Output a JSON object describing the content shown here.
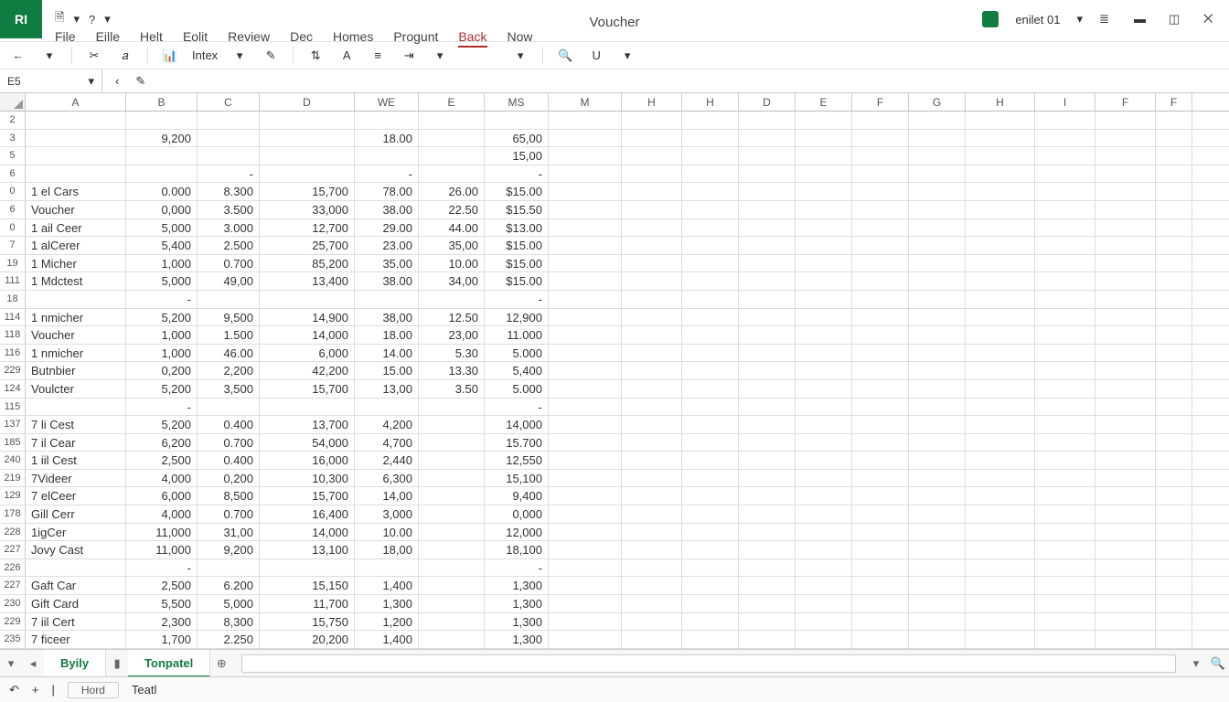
{
  "app_badge": "RI",
  "title": "Voucher",
  "account": "enilet 01",
  "qat": {
    "undo": "↶",
    "help": "?",
    "drop": "▾"
  },
  "menus": [
    "File",
    "Eille",
    "Helt",
    "Eolit",
    "Review",
    "Dec",
    "Homes",
    "Progunt",
    "Back",
    "Now"
  ],
  "active_menu": 8,
  "toolbar": {
    "back": "←",
    "intex": "Intex"
  },
  "namebox": "E5",
  "columns": [
    "A",
    "B",
    "C",
    "D",
    "WE",
    "E",
    "MS",
    "M",
    "H",
    "H",
    "D",
    "E",
    "F",
    "G",
    "H",
    "I",
    "F",
    "F"
  ],
  "col_classes": [
    "wA",
    "wB",
    "wC",
    "wD",
    "wWE",
    "wE",
    "wMS",
    "wM",
    "wH",
    "wHH",
    "wD2",
    "wE2",
    "wF",
    "wG",
    "wH2",
    "wI",
    "wF2",
    "wF3"
  ],
  "rows": [
    {
      "n": "2",
      "c": [
        "",
        "",
        "",
        "",
        "",
        "",
        "",
        "",
        "",
        "",
        "",
        "",
        "",
        "",
        "",
        "",
        "",
        ""
      ]
    },
    {
      "n": "3",
      "c": [
        "",
        "9,200",
        "",
        "",
        "18.00",
        "",
        "65,00",
        "",
        "",
        "",
        "",
        "",
        "",
        "",
        "",
        "",
        "",
        ""
      ]
    },
    {
      "n": "5",
      "c": [
        "",
        "",
        "",
        "",
        "",
        "",
        "15,00",
        "",
        "",
        "",
        "",
        "",
        "",
        "",
        "",
        "",
        "",
        ""
      ]
    },
    {
      "n": "6",
      "c": [
        "",
        "",
        "-",
        "",
        "-",
        "",
        "-",
        "",
        "",
        "",
        "",
        "",
        "",
        "",
        "",
        "",
        "",
        ""
      ]
    },
    {
      "n": "0",
      "c": [
        "1 el Cars",
        "0.000",
        "8.300",
        "15,700",
        "78.00",
        "26.00",
        "$15.00",
        "",
        "",
        "",
        "",
        "",
        "",
        "",
        "",
        "",
        "",
        ""
      ]
    },
    {
      "n": "6",
      "c": [
        "Voucher",
        "0,000",
        "3.500",
        "33,000",
        "38.00",
        "22.50",
        "$15.50",
        "",
        "",
        "",
        "",
        "",
        "",
        "",
        "",
        "",
        "",
        ""
      ]
    },
    {
      "n": "0",
      "c": [
        "1 ail Ceer",
        "5,000",
        "3.000",
        "12,700",
        "29.00",
        "44.00",
        "$13.00",
        "",
        "",
        "",
        "",
        "",
        "",
        "",
        "",
        "",
        "",
        ""
      ]
    },
    {
      "n": "7",
      "c": [
        "1 alCerer",
        "5,400",
        "2.500",
        "25,700",
        "23.00",
        "35,00",
        "$15.00",
        "",
        "",
        "",
        "",
        "",
        "",
        "",
        "",
        "",
        "",
        ""
      ]
    },
    {
      "n": "19",
      "c": [
        "1 Micher",
        "1,000",
        "0.700",
        "85,200",
        "35.00",
        "10.00",
        "$15.00",
        "",
        "",
        "",
        "",
        "",
        "",
        "",
        "",
        "",
        "",
        ""
      ]
    },
    {
      "n": "111",
      "c": [
        "1 Mdctest",
        "5,000",
        "49,00",
        "13,400",
        "38.00",
        "34,00",
        "$15.00",
        "",
        "",
        "",
        "",
        "",
        "",
        "",
        "",
        "",
        "",
        ""
      ]
    },
    {
      "n": "18",
      "c": [
        "",
        "-",
        "",
        "",
        "",
        "",
        "-",
        "",
        "",
        "",
        "",
        "",
        "",
        "",
        "",
        "",
        "",
        ""
      ]
    },
    {
      "n": "114",
      "c": [
        "1 nmicher",
        "5,200",
        "9,500",
        "14,900",
        "38,00",
        "12.50",
        "12,900",
        "",
        "",
        "",
        "",
        "",
        "",
        "",
        "",
        "",
        "",
        ""
      ]
    },
    {
      "n": "118",
      "c": [
        "Voucher",
        "1,000",
        "1.500",
        "14,000",
        "18.00",
        "23,00",
        "11.000",
        "",
        "",
        "",
        "",
        "",
        "",
        "",
        "",
        "",
        "",
        ""
      ]
    },
    {
      "n": "116",
      "c": [
        "1 nmicher",
        "1,000",
        "46.00",
        "6,000",
        "14.00",
        "5.30",
        "5.000",
        "",
        "",
        "",
        "",
        "",
        "",
        "",
        "",
        "",
        "",
        ""
      ]
    },
    {
      "n": "229",
      "c": [
        "Butnbier",
        "0,200",
        "2,200",
        "42,200",
        "15.00",
        "13.30",
        "5,400",
        "",
        "",
        "",
        "",
        "",
        "",
        "",
        "",
        "",
        "",
        ""
      ]
    },
    {
      "n": "124",
      "c": [
        "Voulcter",
        "5,200",
        "3,500",
        "15,700",
        "13,00",
        "3.50",
        "5.000",
        "",
        "",
        "",
        "",
        "",
        "",
        "",
        "",
        "",
        "",
        ""
      ]
    },
    {
      "n": "115",
      "c": [
        "",
        "-",
        "",
        "",
        "",
        "",
        "-",
        "",
        "",
        "",
        "",
        "",
        "",
        "",
        "",
        "",
        "",
        ""
      ]
    },
    {
      "n": "137",
      "c": [
        "7 li Cest",
        "5,200",
        "0.400",
        "13,700",
        "4,200",
        "",
        "14,000",
        "",
        "",
        "",
        "",
        "",
        "",
        "",
        "",
        "",
        "",
        ""
      ]
    },
    {
      "n": "185",
      "c": [
        "7 il Cear",
        "6,200",
        "0.700",
        "54,000",
        "4,700",
        "",
        "15.700",
        "",
        "",
        "",
        "",
        "",
        "",
        "",
        "",
        "",
        "",
        ""
      ]
    },
    {
      "n": "240",
      "c": [
        "1 iil Cest",
        "2,500",
        "0.400",
        "16,000",
        "2,440",
        "",
        "12,550",
        "",
        "",
        "",
        "",
        "",
        "",
        "",
        "",
        "",
        "",
        ""
      ]
    },
    {
      "n": "219",
      "c": [
        "7Videer",
        "4,000",
        "0,200",
        "10,300",
        "6,300",
        "",
        "15,100",
        "",
        "",
        "",
        "",
        "",
        "",
        "",
        "",
        "",
        "",
        ""
      ]
    },
    {
      "n": "129",
      "c": [
        "7 elCeer",
        "6,000",
        "8,500",
        "15,700",
        "14,00",
        "",
        "9,400",
        "",
        "",
        "",
        "",
        "",
        "",
        "",
        "",
        "",
        "",
        ""
      ]
    },
    {
      "n": "178",
      "c": [
        "Gill Cerr",
        "4,000",
        "0.700",
        "16,400",
        "3,000",
        "",
        "0,000",
        "",
        "",
        "",
        "",
        "",
        "",
        "",
        "",
        "",
        "",
        ""
      ]
    },
    {
      "n": "228",
      "c": [
        "1igCer",
        "11,000",
        "31,00",
        "14,000",
        "10.00",
        "",
        "12,000",
        "",
        "",
        "",
        "",
        "",
        "",
        "",
        "",
        "",
        "",
        ""
      ]
    },
    {
      "n": "227",
      "c": [
        "Jovy Cast",
        "11,000",
        "9,200",
        "13,100",
        "18,00",
        "",
        "18,100",
        "",
        "",
        "",
        "",
        "",
        "",
        "",
        "",
        "",
        "",
        ""
      ]
    },
    {
      "n": "226",
      "c": [
        "",
        "-",
        "",
        "",
        "",
        "",
        "-",
        "",
        "",
        "",
        "",
        "",
        "",
        "",
        "",
        "",
        "",
        ""
      ]
    },
    {
      "n": "227",
      "c": [
        "Gaft Car",
        "2,500",
        "6.200",
        "15,150",
        "1,400",
        "",
        "1,300",
        "",
        "",
        "",
        "",
        "",
        "",
        "",
        "",
        "",
        "",
        ""
      ]
    },
    {
      "n": "230",
      "c": [
        "Gift Card",
        "5,500",
        "5,000",
        "11,700",
        "1,300",
        "",
        "1,300",
        "",
        "",
        "",
        "",
        "",
        "",
        "",
        "",
        "",
        "",
        ""
      ]
    },
    {
      "n": "229",
      "c": [
        "7 iil Cert",
        "2,300",
        "8,300",
        "15,750",
        "1,200",
        "",
        "1,300",
        "",
        "",
        "",
        "",
        "",
        "",
        "",
        "",
        "",
        "",
        ""
      ]
    },
    {
      "n": "235",
      "c": [
        "7 ficeer",
        "1,700",
        "2.250",
        "20,200",
        "1,400",
        "",
        "1,300",
        "",
        "",
        "",
        "",
        "",
        "",
        "",
        "",
        "",
        "",
        ""
      ]
    }
  ],
  "tabs": [
    "Byily",
    "Tonpatel"
  ],
  "status": [
    "Hord",
    "Teatl"
  ]
}
